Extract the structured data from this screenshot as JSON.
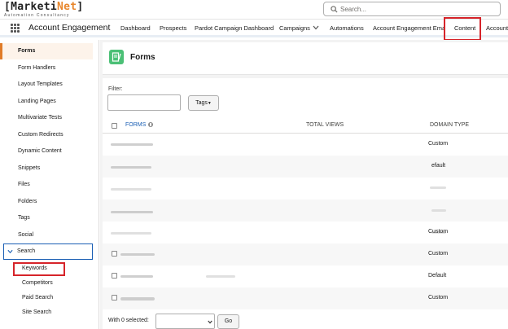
{
  "brand": {
    "logo_bracket_open": "[",
    "logo_a": "Marketi",
    "logo_b": "Net",
    "logo_bracket_close": "]",
    "tagline": "Automation Consultancy",
    "accent": "#e8862b"
  },
  "search": {
    "placeholder": "Search..."
  },
  "nav": {
    "app_name": "Account Engagement",
    "items": [
      "Dashboard",
      "Prospects",
      "Pardot Campaign Dashboard",
      "Campaigns",
      "Automations",
      "Account Engagement Email",
      "Content",
      "Account"
    ],
    "active": "Content"
  },
  "sidebar": {
    "items": [
      "Forms",
      "Form Handlers",
      "Layout Templates",
      "Landing Pages",
      "Multivariate Tests",
      "Custom Redirects",
      "Dynamic Content",
      "Snippets",
      "Files",
      "Folders",
      "Tags",
      "Social"
    ],
    "search_section": "Search",
    "search_items": [
      "Keywords",
      "Competitors",
      "Paid Search",
      "Site Search"
    ]
  },
  "page": {
    "title": "Forms",
    "icon": "forms-icon"
  },
  "filter": {
    "label": "Filter:",
    "value": ""
  },
  "tags_button": "Tags",
  "table": {
    "columns": [
      "FORMS",
      "TOTAL VIEWS",
      "DOMAIN TYPE"
    ],
    "rows": [
      {
        "domain": "Custom"
      },
      {
        "domain": "efault"
      },
      {
        "domain": ""
      },
      {
        "domain": ""
      },
      {
        "domain": "Custom"
      },
      {
        "domain": "Custom"
      },
      {
        "domain": "Default"
      },
      {
        "domain": "Custom"
      }
    ]
  },
  "footer": {
    "with_selected": "With 0 selected:",
    "go": "Go"
  },
  "colors": {
    "highlight_red": "#d6242a",
    "link_blue": "#1b5fb4",
    "forms_green": "#4bc076"
  }
}
